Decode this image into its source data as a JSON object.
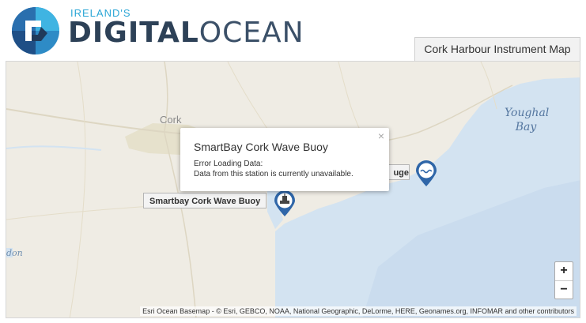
{
  "header": {
    "logo_small": "IRELAND'S",
    "logo_bold": "DIGITAL",
    "logo_light": "OCEAN",
    "tab_label": "Cork Harbour Instrument Map"
  },
  "map": {
    "places": {
      "cork": "Cork",
      "youghal": "Youghal Bay",
      "don": "don"
    },
    "popup": {
      "title": "SmartBay Cork Wave Buoy",
      "line1": "Error Loading Data:",
      "line2": "Data from this station is currently unavailable.",
      "close": "×"
    },
    "labels": {
      "buoy": "Smartbay Cork Wave Buoy",
      "gauge": "uge"
    },
    "zoom": {
      "in": "+",
      "out": "−"
    },
    "attribution": "Esri Ocean Basemap - © Esri, GEBCO, NOAA, National Geographic, DeLorme, HERE, Geonames.org, INFOMAR and other contributors"
  },
  "colors": {
    "land": "#efece4",
    "sea": "#d3e3f1",
    "marker": "#2f66a8",
    "accent": "#2aa6d6"
  },
  "icons": {
    "buoy_marker": "buoy-marker-icon",
    "wave_marker": "wave-gauge-marker-icon"
  }
}
